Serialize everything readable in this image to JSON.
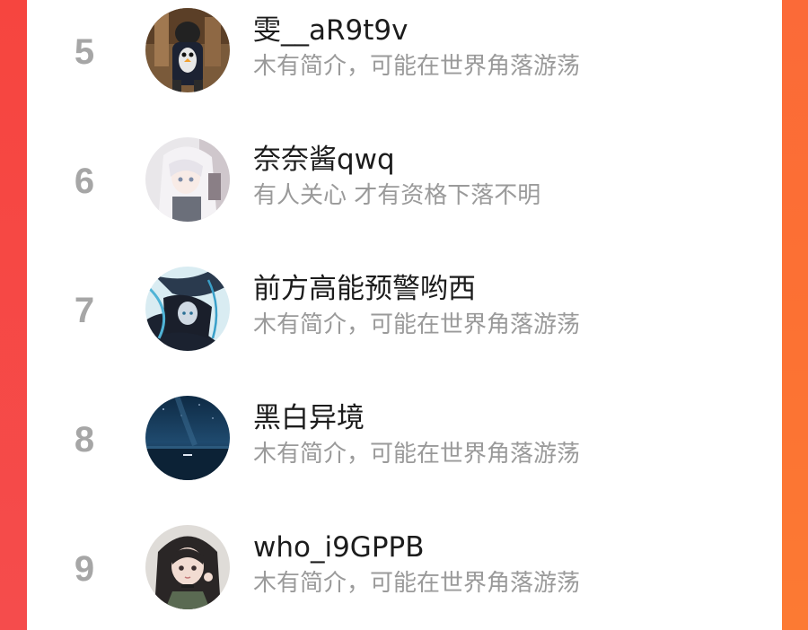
{
  "colors": {
    "panel_bg": "#ffffff",
    "rank_color": "#a6a6a6",
    "name_color": "#1c1c1c",
    "bio_color": "#9a9a9a",
    "frame_left": "#f54a4a",
    "frame_right": "#fd6d3a"
  },
  "ranking": {
    "items": [
      {
        "rank": "5",
        "name": "雯__aR9t9v",
        "bio": "木有简介，可能在世界角落游荡",
        "avatar": "penguin-costume-avatar"
      },
      {
        "rank": "6",
        "name": "奈奈酱qwq",
        "bio": "有人关心 才有资格下落不明",
        "avatar": "white-hair-anime-avatar"
      },
      {
        "rank": "7",
        "name": "前方高能预警哟西",
        "bio": "木有简介，可能在世界角落游荡",
        "avatar": "dark-anime-character-avatar"
      },
      {
        "rank": "8",
        "name": "黑白异境",
        "bio": "木有简介，可能在世界角落游荡",
        "avatar": "night-ocean-avatar"
      },
      {
        "rank": "9",
        "name": "who_i9GPPB",
        "bio": "木有简介，可能在世界角落游荡",
        "avatar": "anime-girl-avatar"
      }
    ]
  }
}
